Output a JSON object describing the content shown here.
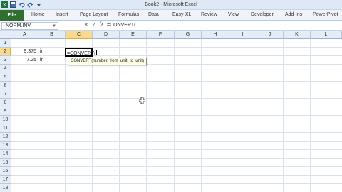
{
  "window": {
    "title": "Book2 - Microsoft Excel"
  },
  "qat": {
    "icons": [
      "excel-logo-icon",
      "save-icon",
      "undo-icon",
      "redo-icon",
      "customize-icon"
    ]
  },
  "ribbon": {
    "file_label": "File",
    "tabs": [
      "Home",
      "Insert",
      "Page Layout",
      "Formulas",
      "Data",
      "Easy-XL",
      "Review",
      "View",
      "Developer",
      "Add-Ins",
      "PowerPivot"
    ]
  },
  "formula_bar": {
    "name_box": "NORM.INV",
    "cancel_label": "✕",
    "enter_label": "✓",
    "fx_label": "fx",
    "formula": "=CONVERT("
  },
  "sheet": {
    "columns": [
      "A",
      "B",
      "C",
      "D",
      "E",
      "F",
      "G",
      "H",
      "I",
      "J",
      "K",
      "L"
    ],
    "rows": [
      "1",
      "2",
      "3",
      "4",
      "5",
      "6",
      "7",
      "8",
      "9",
      "10",
      "11",
      "12",
      "13",
      "14",
      "15",
      "16",
      "17",
      "18"
    ],
    "active_column": "C",
    "active_row": "2",
    "cells": {
      "a2": "9.375",
      "b2": "in",
      "a3": "7.25",
      "b3": "in",
      "c2": "=CONVERT("
    }
  },
  "tooltip": {
    "function": "CONVERT",
    "args": "(number, from_unit, to_unit)"
  },
  "colors": {
    "file_tab": "#2f6f2f",
    "active_header": "#f9d98f"
  }
}
